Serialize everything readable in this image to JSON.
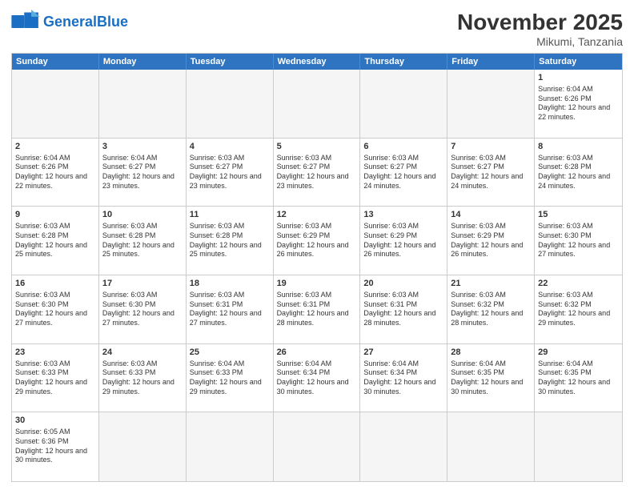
{
  "header": {
    "logo_general": "General",
    "logo_blue": "Blue",
    "month_year": "November 2025",
    "location": "Mikumi, Tanzania"
  },
  "days_of_week": [
    "Sunday",
    "Monday",
    "Tuesday",
    "Wednesday",
    "Thursday",
    "Friday",
    "Saturday"
  ],
  "weeks": [
    [
      {
        "day": "",
        "empty": true
      },
      {
        "day": "",
        "empty": true
      },
      {
        "day": "",
        "empty": true
      },
      {
        "day": "",
        "empty": true
      },
      {
        "day": "",
        "empty": true
      },
      {
        "day": "",
        "empty": true
      },
      {
        "day": "1",
        "sunrise": "6:04 AM",
        "sunset": "6:26 PM",
        "daylight": "12 hours and 22 minutes."
      }
    ],
    [
      {
        "day": "2",
        "sunrise": "6:04 AM",
        "sunset": "6:26 PM",
        "daylight": "12 hours and 22 minutes."
      },
      {
        "day": "3",
        "sunrise": "6:04 AM",
        "sunset": "6:27 PM",
        "daylight": "12 hours and 23 minutes."
      },
      {
        "day": "4",
        "sunrise": "6:03 AM",
        "sunset": "6:27 PM",
        "daylight": "12 hours and 23 minutes."
      },
      {
        "day": "5",
        "sunrise": "6:03 AM",
        "sunset": "6:27 PM",
        "daylight": "12 hours and 23 minutes."
      },
      {
        "day": "6",
        "sunrise": "6:03 AM",
        "sunset": "6:27 PM",
        "daylight": "12 hours and 24 minutes."
      },
      {
        "day": "7",
        "sunrise": "6:03 AM",
        "sunset": "6:27 PM",
        "daylight": "12 hours and 24 minutes."
      },
      {
        "day": "8",
        "sunrise": "6:03 AM",
        "sunset": "6:28 PM",
        "daylight": "12 hours and 24 minutes."
      }
    ],
    [
      {
        "day": "9",
        "sunrise": "6:03 AM",
        "sunset": "6:28 PM",
        "daylight": "12 hours and 25 minutes."
      },
      {
        "day": "10",
        "sunrise": "6:03 AM",
        "sunset": "6:28 PM",
        "daylight": "12 hours and 25 minutes."
      },
      {
        "day": "11",
        "sunrise": "6:03 AM",
        "sunset": "6:28 PM",
        "daylight": "12 hours and 25 minutes."
      },
      {
        "day": "12",
        "sunrise": "6:03 AM",
        "sunset": "6:29 PM",
        "daylight": "12 hours and 26 minutes."
      },
      {
        "day": "13",
        "sunrise": "6:03 AM",
        "sunset": "6:29 PM",
        "daylight": "12 hours and 26 minutes."
      },
      {
        "day": "14",
        "sunrise": "6:03 AM",
        "sunset": "6:29 PM",
        "daylight": "12 hours and 26 minutes."
      },
      {
        "day": "15",
        "sunrise": "6:03 AM",
        "sunset": "6:30 PM",
        "daylight": "12 hours and 27 minutes."
      }
    ],
    [
      {
        "day": "16",
        "sunrise": "6:03 AM",
        "sunset": "6:30 PM",
        "daylight": "12 hours and 27 minutes."
      },
      {
        "day": "17",
        "sunrise": "6:03 AM",
        "sunset": "6:30 PM",
        "daylight": "12 hours and 27 minutes."
      },
      {
        "day": "18",
        "sunrise": "6:03 AM",
        "sunset": "6:31 PM",
        "daylight": "12 hours and 27 minutes."
      },
      {
        "day": "19",
        "sunrise": "6:03 AM",
        "sunset": "6:31 PM",
        "daylight": "12 hours and 28 minutes."
      },
      {
        "day": "20",
        "sunrise": "6:03 AM",
        "sunset": "6:31 PM",
        "daylight": "12 hours and 28 minutes."
      },
      {
        "day": "21",
        "sunrise": "6:03 AM",
        "sunset": "6:32 PM",
        "daylight": "12 hours and 28 minutes."
      },
      {
        "day": "22",
        "sunrise": "6:03 AM",
        "sunset": "6:32 PM",
        "daylight": "12 hours and 29 minutes."
      }
    ],
    [
      {
        "day": "23",
        "sunrise": "6:03 AM",
        "sunset": "6:33 PM",
        "daylight": "12 hours and 29 minutes."
      },
      {
        "day": "24",
        "sunrise": "6:03 AM",
        "sunset": "6:33 PM",
        "daylight": "12 hours and 29 minutes."
      },
      {
        "day": "25",
        "sunrise": "6:04 AM",
        "sunset": "6:33 PM",
        "daylight": "12 hours and 29 minutes."
      },
      {
        "day": "26",
        "sunrise": "6:04 AM",
        "sunset": "6:34 PM",
        "daylight": "12 hours and 30 minutes."
      },
      {
        "day": "27",
        "sunrise": "6:04 AM",
        "sunset": "6:34 PM",
        "daylight": "12 hours and 30 minutes."
      },
      {
        "day": "28",
        "sunrise": "6:04 AM",
        "sunset": "6:35 PM",
        "daylight": "12 hours and 30 minutes."
      },
      {
        "day": "29",
        "sunrise": "6:04 AM",
        "sunset": "6:35 PM",
        "daylight": "12 hours and 30 minutes."
      }
    ],
    [
      {
        "day": "30",
        "sunrise": "6:05 AM",
        "sunset": "6:36 PM",
        "daylight": "12 hours and 30 minutes."
      },
      {
        "day": "",
        "empty": true
      },
      {
        "day": "",
        "empty": true
      },
      {
        "day": "",
        "empty": true
      },
      {
        "day": "",
        "empty": true
      },
      {
        "day": "",
        "empty": true
      },
      {
        "day": "",
        "empty": true
      }
    ]
  ]
}
